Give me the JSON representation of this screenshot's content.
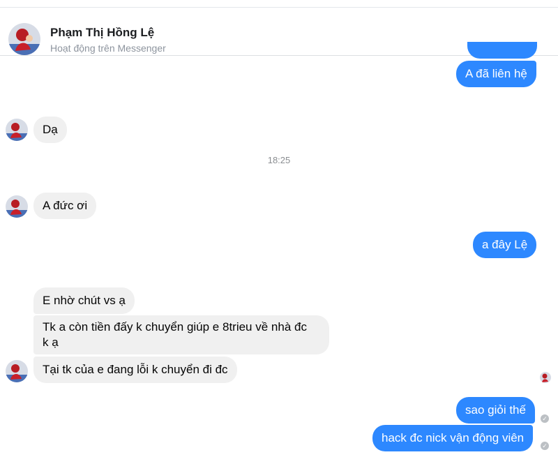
{
  "header": {
    "contact_name": "Phạm Thị Hồng Lệ",
    "status": "Hoạt động trên Messenger"
  },
  "conversation": {
    "timestamp": "18:25",
    "messages": [
      {
        "direction": "outgoing",
        "text": "A đã liên hệ"
      },
      {
        "direction": "incoming",
        "text": "Dạ"
      },
      {
        "direction": "incoming",
        "text": "A đức ơi"
      },
      {
        "direction": "outgoing",
        "text": "a đây Lệ"
      },
      {
        "direction": "incoming",
        "text": "E nhờ chút vs ạ"
      },
      {
        "direction": "incoming",
        "text_line1": "Tk a còn tiền đấy k chuyển giúp e 8trieu về nhà đc",
        "text_line2": "k ạ"
      },
      {
        "direction": "incoming",
        "text": "Tại tk của e đang lỗi k chuyển đi đc"
      },
      {
        "direction": "outgoing",
        "text": "sao giỏi thế"
      },
      {
        "direction": "outgoing",
        "text": "hack đc nick vận động viên"
      }
    ]
  },
  "colors": {
    "outgoing_bubble": "#2d88ff",
    "incoming_bubble": "#f0f0f0",
    "status_text": "#8d949e"
  },
  "icons": {
    "avatar": "profile-photo",
    "delivered": "check-circle-icon"
  }
}
